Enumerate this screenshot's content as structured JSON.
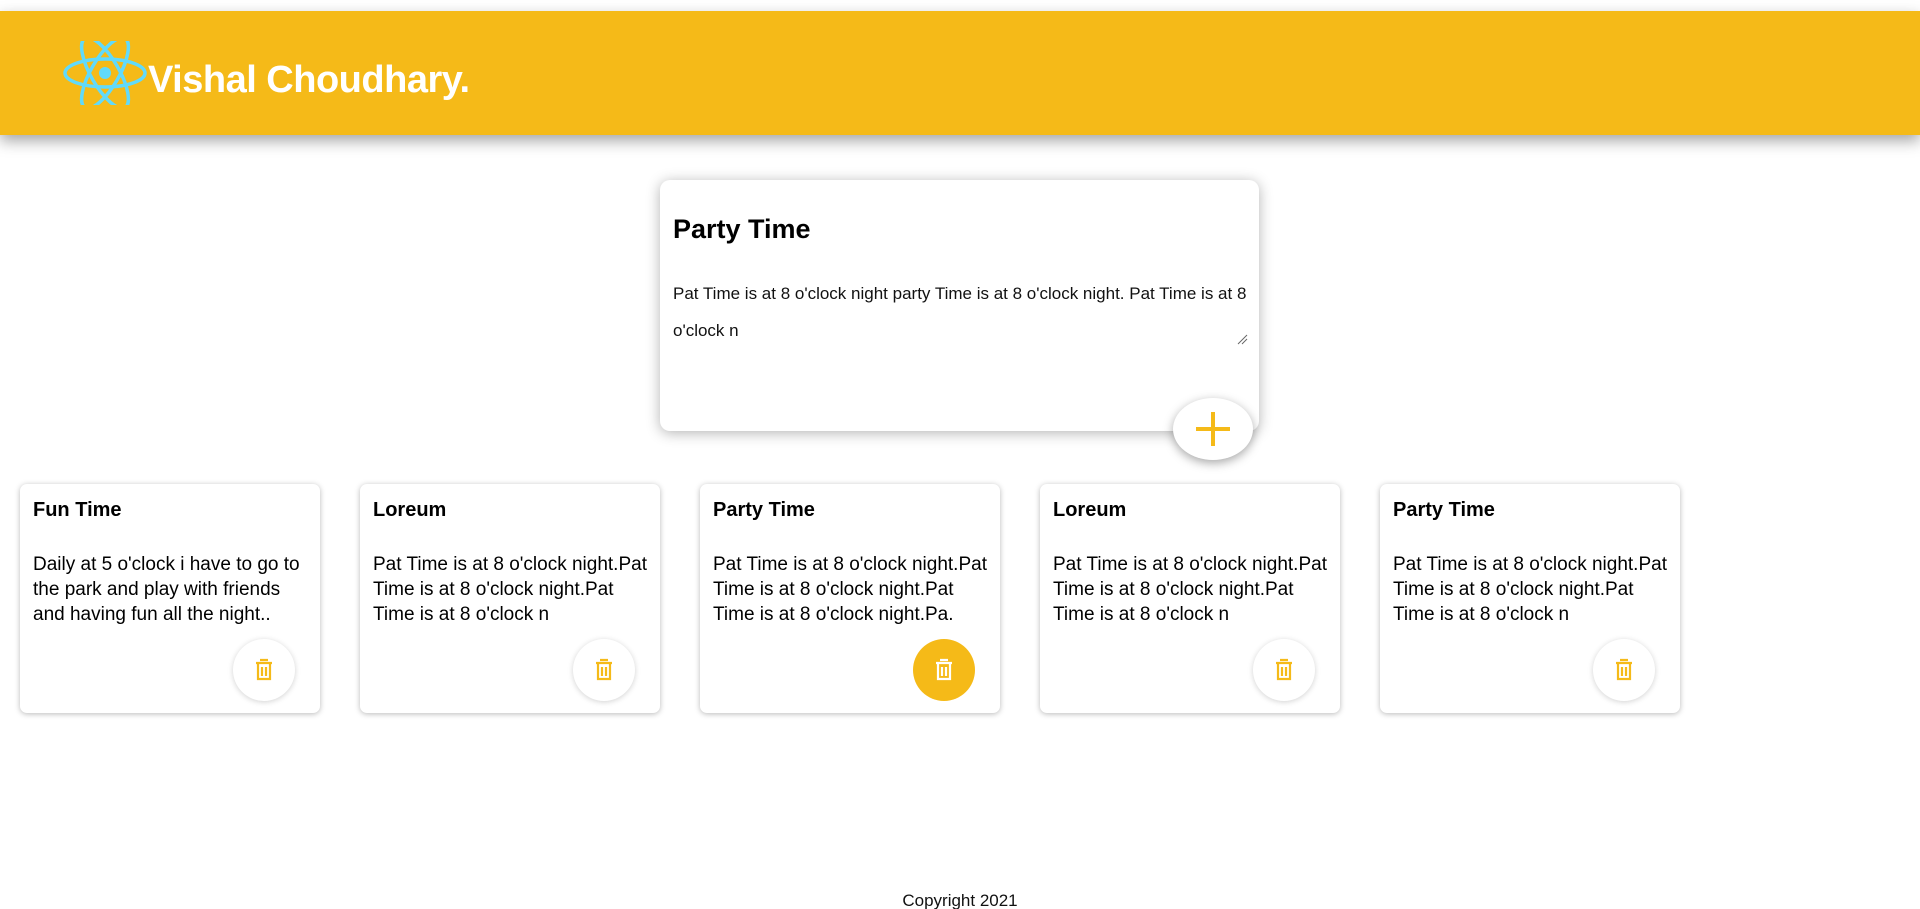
{
  "header": {
    "brand": "Vishal Choudhary.",
    "logo_icon": "react-atom-icon",
    "background": "#f5ba18"
  },
  "create_note": {
    "title": "Party Time",
    "content": "Pat Time is at 8 o'clock night party Time is at 8 o'clock night. Pat Time is at 8 o'clock n",
    "add_icon": "plus-icon"
  },
  "notes": [
    {
      "title": "Fun Time",
      "body": "Daily at 5 o'clock i have to go to the park and play with friends and having fun all the night.."
    },
    {
      "title": "Loreum",
      "body": "Pat Time is at 8 o'clock night.Pat Time is at 8 o'clock night.Pat Time is at 8 o'clock n"
    },
    {
      "title": "Party Time",
      "body": "Pat Time is at 8 o'clock night.Pat Time is at 8 o'clock night.Pat Time is at 8 o'clock night.Pa."
    },
    {
      "title": "Loreum",
      "body": "Pat Time is at 8 o'clock night.Pat Time is at 8 o'clock night.Pat Time is at 8 o'clock n"
    },
    {
      "title": "Party Time",
      "body": "Pat Time is at 8 o'clock night.Pat Time is at 8 o'clock night.Pat Time is at 8 o'clock n"
    }
  ],
  "delete_icon": "trash-icon",
  "accent_color": "#f5ba18",
  "footer": {
    "copyright": "Copyright 2021"
  }
}
